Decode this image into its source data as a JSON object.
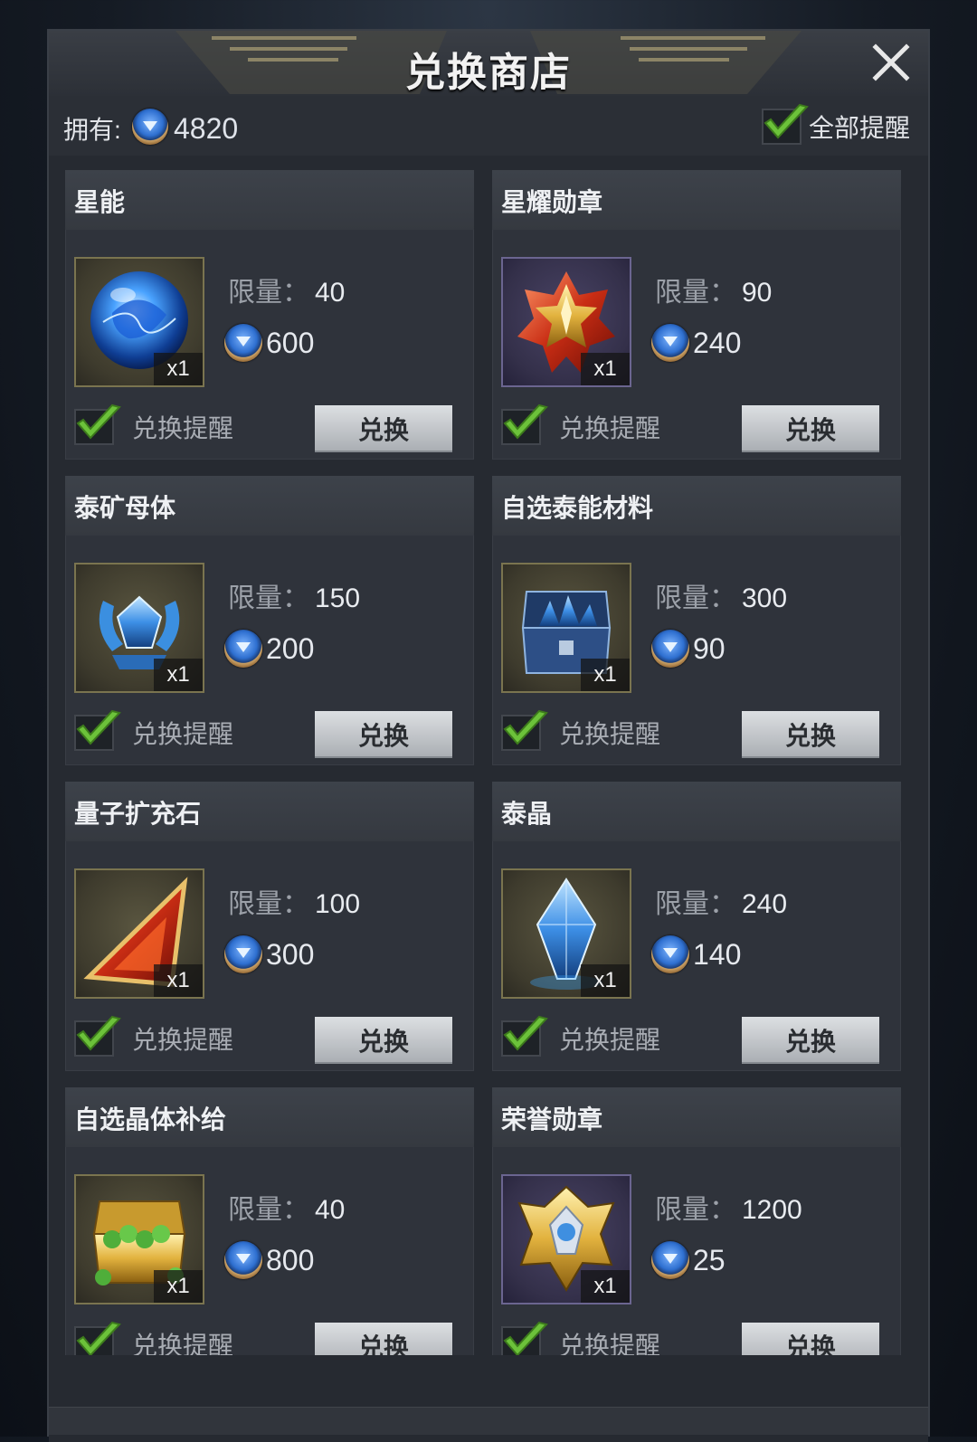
{
  "title": "兑换商店",
  "owned": {
    "label": "拥有:",
    "amount": "4820"
  },
  "remind_all": {
    "label": "全部提醒",
    "checked": true
  },
  "colors": {
    "check_green": "#6cc23a",
    "coin_blue": "#2e6fd0"
  },
  "items": [
    {
      "name": "星能",
      "limit_label": "限量：",
      "limit": "40",
      "price": "600",
      "qty": "x1",
      "remind_label": "兑换提醒",
      "button_label": "兑换",
      "icon": "blue-energy-orb-icon"
    },
    {
      "name": "星耀勋章",
      "limit_label": "限量：",
      "limit": "90",
      "price": "240",
      "qty": "x1",
      "remind_label": "兑换提醒",
      "button_label": "兑换",
      "icon": "star-medal-icon"
    },
    {
      "name": "泰矿母体",
      "limit_label": "限量：",
      "limit": "150",
      "price": "200",
      "qty": "x1",
      "remind_label": "兑换提醒",
      "button_label": "兑换",
      "icon": "winged-crystal-icon"
    },
    {
      "name": "自选泰能材料",
      "limit_label": "限量：",
      "limit": "300",
      "price": "90",
      "qty": "x1",
      "remind_label": "兑换提醒",
      "button_label": "兑换",
      "icon": "crystal-chest-icon"
    },
    {
      "name": "量子扩充石",
      "limit_label": "限量：",
      "limit": "100",
      "price": "300",
      "qty": "x1",
      "remind_label": "兑换提醒",
      "button_label": "兑换",
      "icon": "red-triangle-stone-icon"
    },
    {
      "name": "泰晶",
      "limit_label": "限量：",
      "limit": "240",
      "price": "140",
      "qty": "x1",
      "remind_label": "兑换提醒",
      "button_label": "兑换",
      "icon": "blue-crystal-icon"
    },
    {
      "name": "自选晶体补给",
      "limit_label": "限量：",
      "limit": "40",
      "price": "800",
      "qty": "x1",
      "remind_label": "兑换提醒",
      "button_label": "兑换",
      "icon": "gold-treasure-chest-icon"
    },
    {
      "name": "荣誉勋章",
      "limit_label": "限量：",
      "limit": "1200",
      "price": "25",
      "qty": "x1",
      "remind_label": "兑换提醒",
      "button_label": "兑换",
      "icon": "gold-honor-medal-icon"
    }
  ]
}
